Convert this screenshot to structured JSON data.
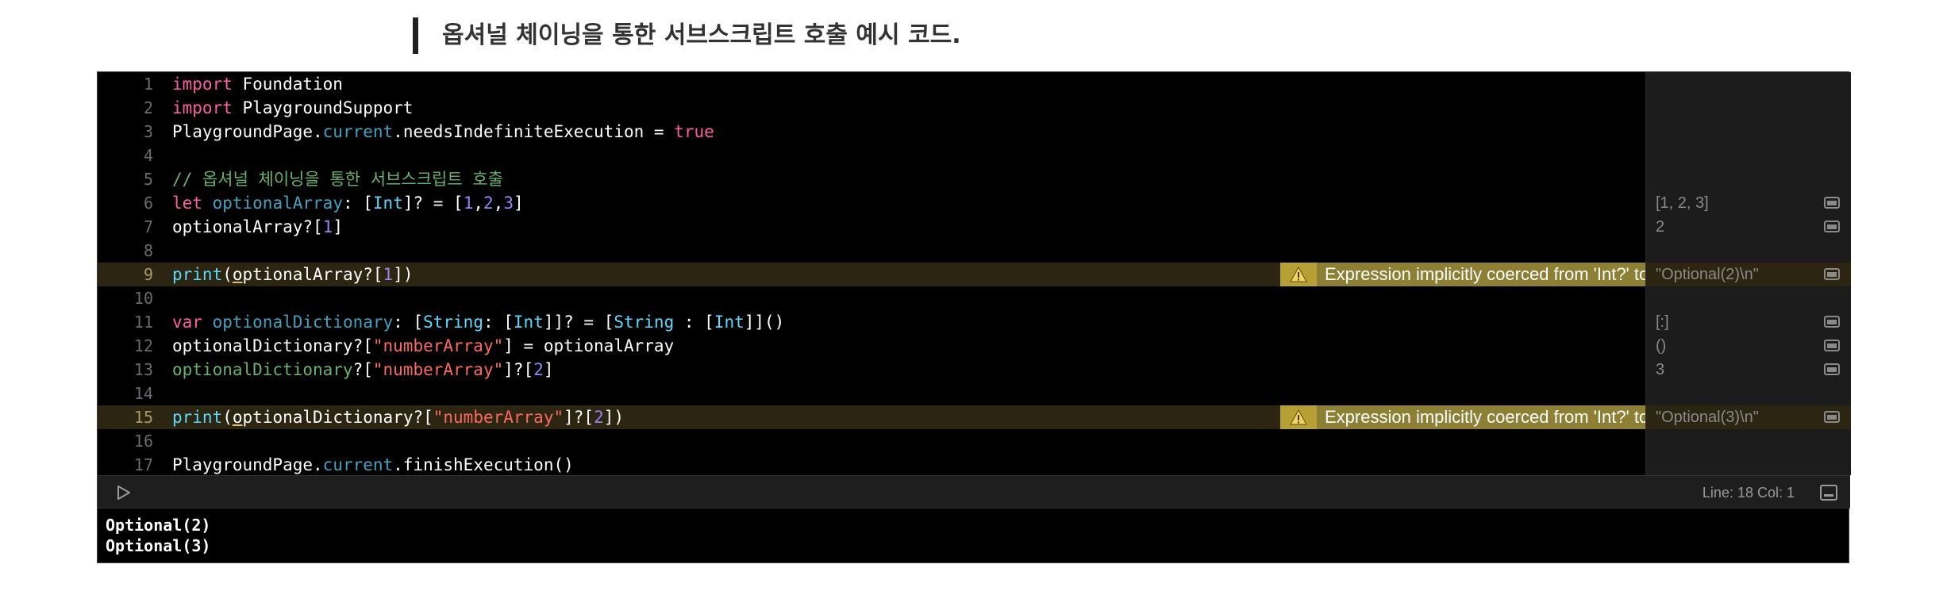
{
  "caption": "옵셔널 체이닝을 통한 서브스크립트 호출 예시 코드.",
  "editor": {
    "lines": [
      {
        "n": "1"
      },
      {
        "n": "2"
      },
      {
        "n": "3"
      },
      {
        "n": "4"
      },
      {
        "n": "5"
      },
      {
        "n": "6"
      },
      {
        "n": "7"
      },
      {
        "n": "8"
      },
      {
        "n": "9"
      },
      {
        "n": "10"
      },
      {
        "n": "11"
      },
      {
        "n": "12"
      },
      {
        "n": "13"
      },
      {
        "n": "14"
      },
      {
        "n": "15"
      },
      {
        "n": "16"
      },
      {
        "n": "17"
      }
    ],
    "tokens": {
      "l1": [
        "import",
        " Foundation"
      ],
      "l2": [
        "import",
        " PlaygroundSupport"
      ],
      "l3": [
        "PlaygroundPage.",
        "current",
        ".needsIndefiniteExecution = ",
        "true"
      ],
      "l5": [
        "// 옵셔널 체이닝을 통한 서브스크립트 호출"
      ],
      "l6": [
        "let",
        " ",
        "optionalArray",
        ": [",
        "Int",
        "]? = [",
        "1",
        ",",
        "2",
        ",",
        "3",
        "]"
      ],
      "l7": [
        "optionalArray?[",
        "1",
        "]"
      ],
      "l9": [
        "print",
        "(",
        "o",
        "ptionalArray?[",
        "1",
        "])"
      ],
      "l11": [
        "var",
        " ",
        "optionalDictionary",
        ": [",
        "String",
        ": [",
        "Int",
        "]]? = [",
        "String",
        " : [",
        "Int",
        "]]()"
      ],
      "l12": [
        "optionalDictionary?[",
        "\"numberArray\"",
        "] = optionalArray"
      ],
      "l13": [
        "optionalDictionary",
        "?[",
        "\"numberArray\"",
        "]?[",
        "2",
        "]"
      ],
      "l15": [
        "print",
        "(",
        "o",
        "ptionalDictionary?[",
        "\"numberArray\"",
        "]?[",
        "2",
        "])"
      ],
      "l17": [
        "PlaygroundPage.",
        "current",
        ".finishExecution()"
      ]
    },
    "warning_text": "Expression implicitly coerced from 'Int?' to 'Any'"
  },
  "results": {
    "r6": "[1, 2, 3]",
    "r7": "2",
    "r9": "\"Optional(2)\\n\"",
    "r11": "[:]",
    "r12": "()",
    "r13": "3",
    "r15": "\"Optional(3)\\n\""
  },
  "toolbar": {
    "status": "Line: 18  Col: 1"
  },
  "console": {
    "lines": [
      "Optional(2)",
      "Optional(3)"
    ]
  },
  "colors": {
    "keyword": "#fc5fa3",
    "type": "#5dd8ff",
    "string": "#fc6a5d",
    "number": "#9686f5",
    "comment": "#67b26f",
    "warning": "#8d7f33",
    "highlight": "#2b2511"
  },
  "icons": [
    "warning-icon",
    "run-icon",
    "quick-look-icon",
    "console-toggle-icon"
  ]
}
